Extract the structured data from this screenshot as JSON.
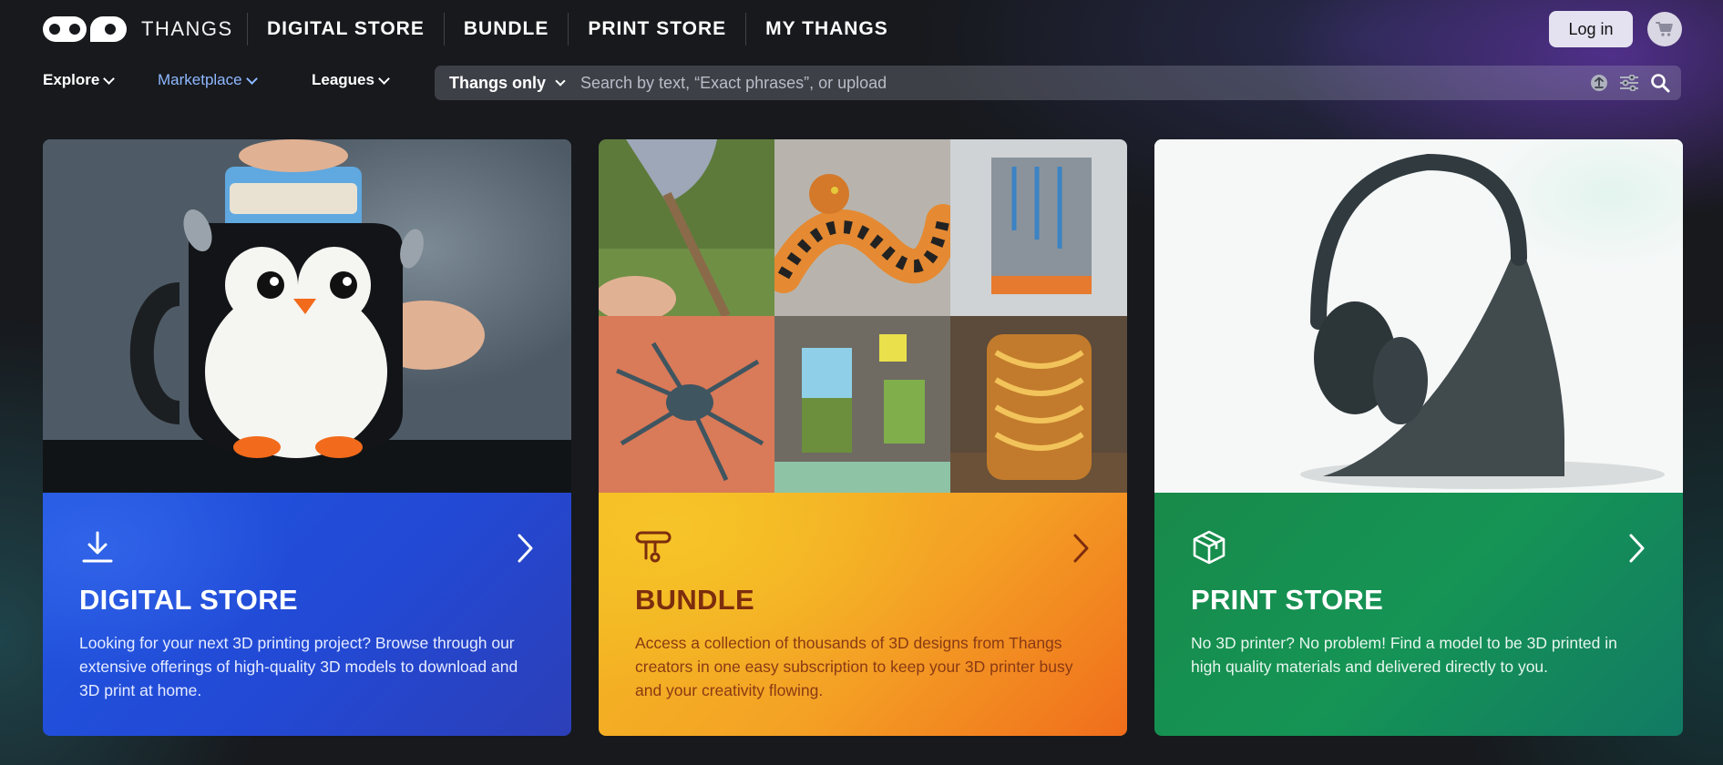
{
  "brand": {
    "name": "THANGS"
  },
  "topnav": {
    "items": [
      "DIGITAL STORE",
      "BUNDLE",
      "PRINT STORE",
      "MY THANGS"
    ]
  },
  "header": {
    "login_label": "Log in"
  },
  "subnav": {
    "explore": "Explore",
    "marketplace": "Marketplace",
    "leagues": "Leagues"
  },
  "search": {
    "scope": "Thangs only",
    "placeholder": "Search by text, “Exact phrases”, or upload"
  },
  "cards": [
    {
      "key": "digital",
      "title": "DIGITAL STORE",
      "description": "Looking for your next 3D printing project? Browse through our extensive offerings of high-quality 3D models to download and 3D print at home.",
      "icon": "download-icon"
    },
    {
      "key": "bundle",
      "title": "BUNDLE",
      "description": "Access a collection of thousands of 3D designs from Thangs creators in one easy subscription to keep your 3D printer busy and your creativity flowing.",
      "icon": "bundle-icon"
    },
    {
      "key": "print",
      "title": "PRINT STORE",
      "description": "No 3D printer? No problem! Find a model to be 3D printed in high quality materials and delivered directly to you.",
      "icon": "package-icon"
    }
  ],
  "colors": {
    "digital": "#2350dc",
    "bundle": "#f4a225",
    "print": "#168c50",
    "marketplace_link": "#8fb8ff",
    "login_bg": "#e4e2f1"
  }
}
